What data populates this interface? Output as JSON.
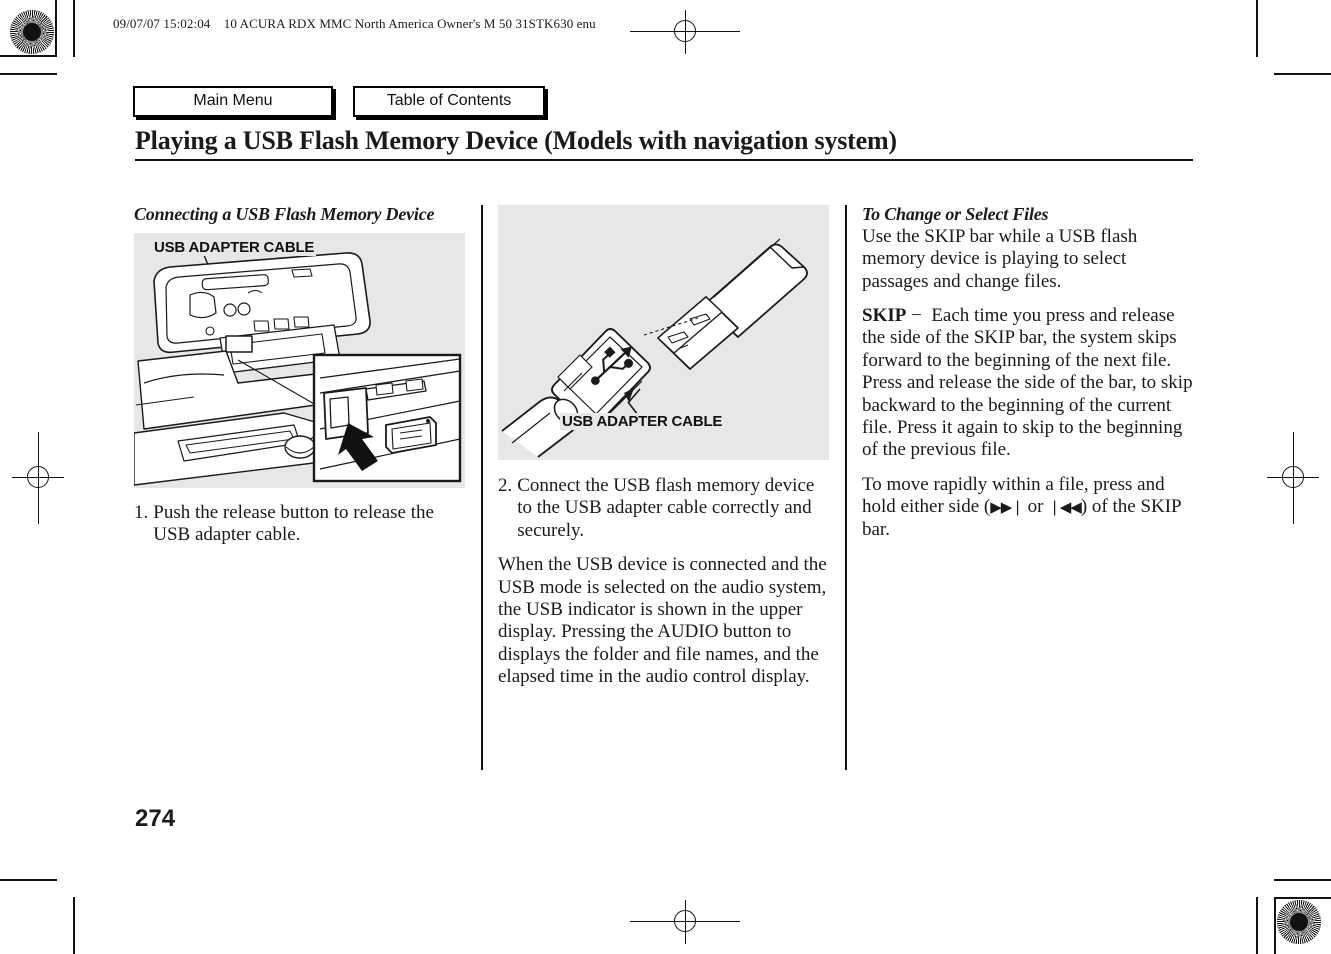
{
  "document": {
    "header_line": "09/07/07 15:02:04    10 ACURA RDX MMC North America Owner's M 50 31STK630 enu",
    "title": "Playing a USB Flash Memory Device (Models with navigation system)",
    "page_number": "274"
  },
  "nav": {
    "main_menu": "Main Menu",
    "table_of_contents": "Table of Contents"
  },
  "left_column": {
    "heading": "Connecting a USB Flash Memory Device",
    "figure_caption": "USB ADAPTER CABLE",
    "step_number": "1.",
    "step_text": "Push the release button to release the USB adapter cable."
  },
  "middle_column": {
    "figure_caption": "USB ADAPTER CABLE",
    "step_number": "2.",
    "step_text": "Connect the USB flash memory device to the USB adapter cable correctly and securely.",
    "paragraph": "When the USB device is connected and the USB mode is selected on the audio system, the USB indicator is shown in the upper display. Pressing the AUDIO button to displays the folder and file names, and the elapsed time in the audio control display."
  },
  "right_column": {
    "heading": "To Change or Select Files",
    "paragraph_1": "Use the SKIP bar while a USB flash memory device is playing to select passages and change files.",
    "skip_label": "SKIP",
    "skip_dash": "−",
    "skip_paragraph": "Each time you press and release the side of the SKIP bar, the system skips forward to the beginning of the next file. Press and release the side of the bar, to skip backward to the beginning of the current file. Press it again to skip to the beginning of the previous file.",
    "move_rapidly_part_1": "To move rapidly within a file, press and hold either side (",
    "skip_forward_icon": "▶▶❘",
    "move_rapidly_or": " or ",
    "skip_back_icon": "❘◀◀",
    "move_rapidly_part_2": ") of the SKIP bar."
  },
  "colors": {
    "figure_background": "#e7e7e7",
    "ink": "#1a1a1a"
  }
}
